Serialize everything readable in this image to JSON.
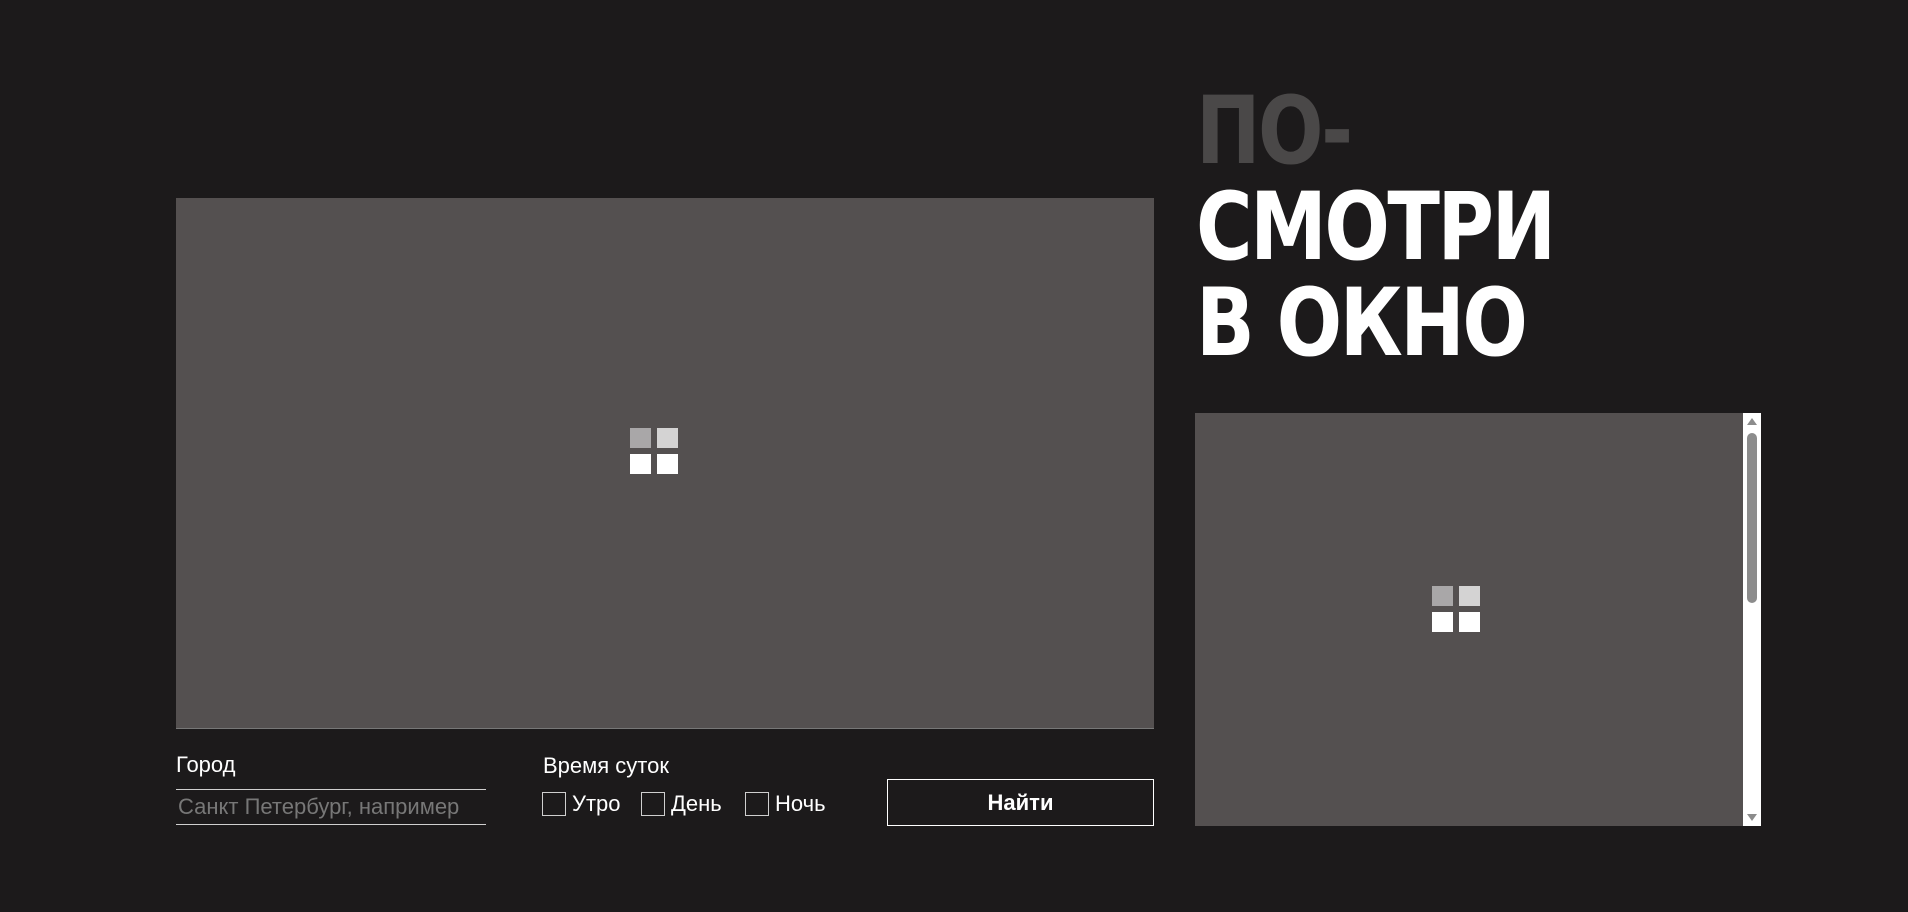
{
  "headline": {
    "line1": "ПО-",
    "line2": "СМОТРИ",
    "line3": "В ОКНО"
  },
  "icons": {
    "main_preview": "window-placeholder-icon",
    "side_preview": "window-placeholder-icon"
  },
  "form": {
    "city_label": "Город",
    "city_placeholder": "Санкт Петербург, например",
    "city_value": "",
    "time_label": "Время суток",
    "options": [
      {
        "label": "Утро",
        "checked": false
      },
      {
        "label": "День",
        "checked": false
      },
      {
        "label": "Ночь",
        "checked": false
      }
    ],
    "search_label": "Найти"
  },
  "colors": {
    "background": "#1c1a1b",
    "preview": "#545050",
    "headline_dim": "#4a4848",
    "text": "#ffffff"
  }
}
